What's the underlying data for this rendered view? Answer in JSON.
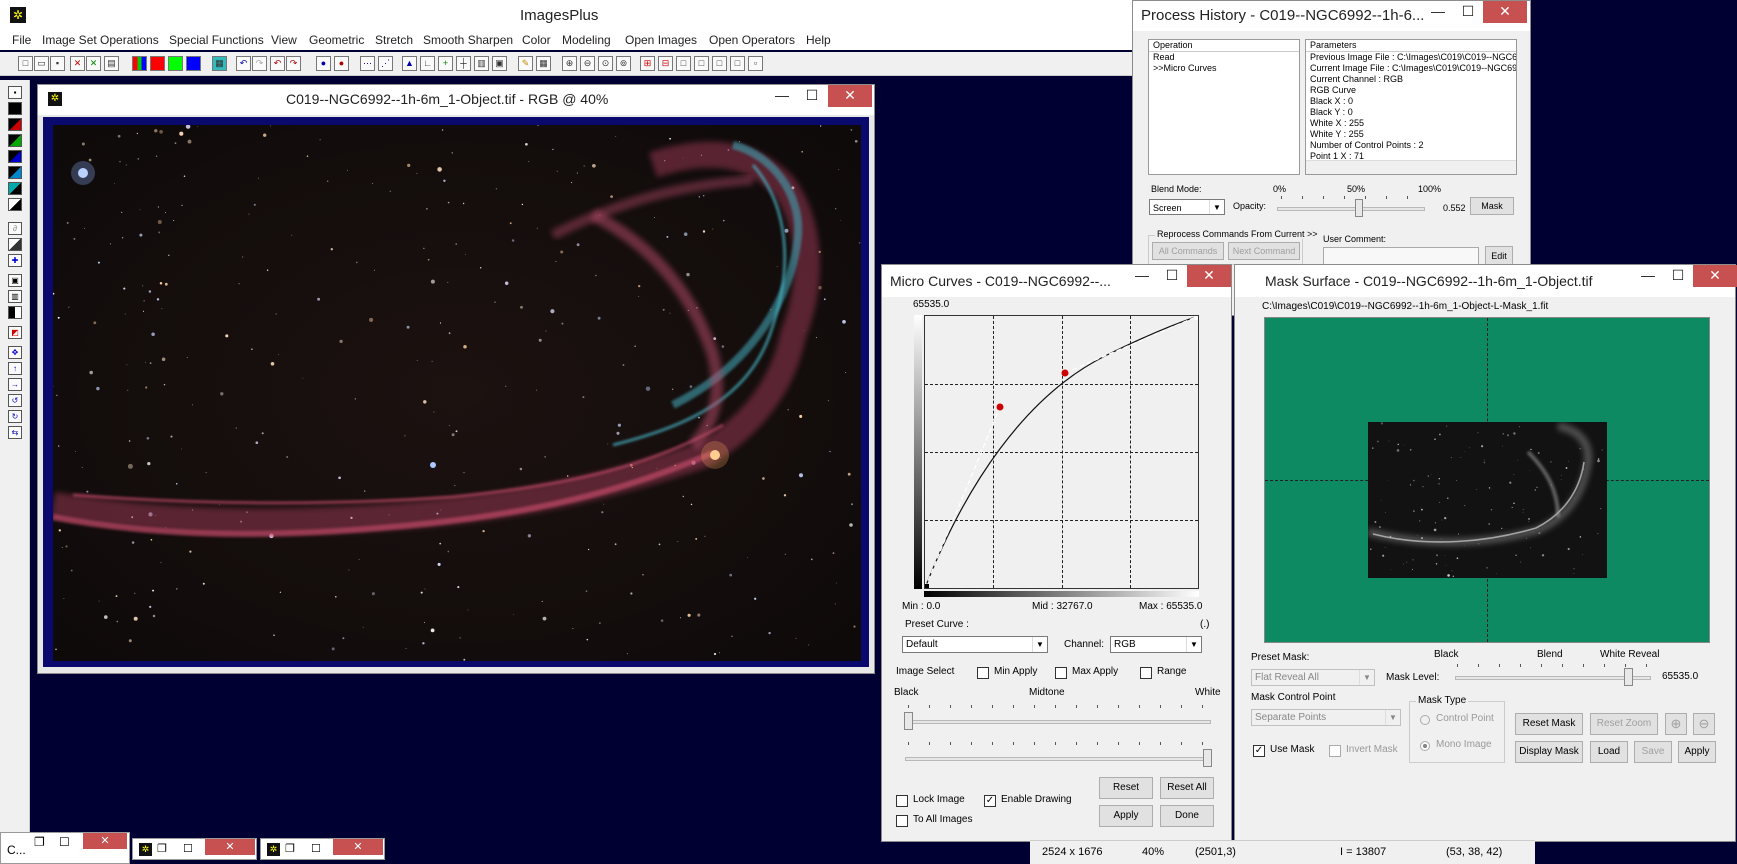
{
  "app": {
    "title": "ImagesPlus"
  },
  "menu": [
    "File",
    "Image Set Operations",
    "Special Functions",
    "View",
    "Geometric",
    "Stretch",
    "Smooth Sharpen",
    "Color",
    "Modeling",
    "Open Images",
    "Open Operators",
    "Help"
  ],
  "image_window": {
    "title": "C019--NGC6992--1h-6m_1-Object.tif - RGB @ 40%"
  },
  "process_history": {
    "title": "Process History - C019--NGC6992--1h-6...",
    "operation_header": "Operation",
    "operations": [
      "Read",
      ">>Micro Curves"
    ],
    "parameters_header": "Parameters",
    "parameters": [
      "Previous Image File : C:\\Images\\C019\\C019--NGC6",
      "Current Image File : C:\\Images\\C019\\C019--NGC69",
      "Current Channel : RGB",
      "RGB Curve",
      "Black X : 0",
      "Black Y : 0",
      "White X : 255",
      "White Y : 255",
      "Number of Control Points : 2",
      "Point 1 X : 71"
    ],
    "blend_mode_label": "Blend Mode:",
    "blend_mode_value": "Screen",
    "opacity_label": "Opacity:",
    "pct_0": "0%",
    "pct_50": "50%",
    "pct_100": "100%",
    "opacity_value": "0.552",
    "opacity_level": 0.552,
    "mask_button": "Mask",
    "reprocess_label": "Reprocess Commands From Current >>",
    "all_commands": "All Commands",
    "next_command": "Next Command",
    "user_comment_label": "User Comment:",
    "edit_button": "Edit"
  },
  "micro_curves": {
    "title": "Micro Curves - C019--NGC6992--...",
    "top_value": "65535.0",
    "min_label": "Min : 0.0",
    "mid_label": "Mid : 32767.0",
    "max_label": "Max : 65535.0",
    "preset_curve_label": "Preset Curve :",
    "preset_curve_suffix": "(.)",
    "preset_value": "Default",
    "channel_label": "Channel:",
    "channel_value": "RGB",
    "image_select_label": "Image Select",
    "min_apply": "Min Apply",
    "max_apply": "Max Apply",
    "range": "Range",
    "black": "Black",
    "midtone": "Midtone",
    "white": "White",
    "lock_image": "Lock Image",
    "enable_drawing": "Enable Drawing",
    "to_all_images": "To All Images",
    "reset": "Reset",
    "reset_all": "Reset All",
    "apply": "Apply",
    "done": "Done",
    "plot_color": "#0e8a62"
  },
  "mask_surface": {
    "title": "Mask Surface - C019--NGC6992--1h-6m_1-Object.tif",
    "path": "C:\\Images\\C019\\C019--NGC6992--1h-6m_1-Object-L-Mask_1.fit",
    "preset_mask_label": "Preset Mask:",
    "preset_mask_value": "Flat Reveal All",
    "black": "Black",
    "blend": "Blend",
    "white_reveal": "White Reveal",
    "mask_level_label": "Mask Level:",
    "mask_level_value": "65535.0",
    "mask_control_point_label": "Mask Control Point",
    "mask_control_point_value": "Separate Points",
    "mask_type_label": "Mask Type",
    "control_point": "Control Point",
    "mono_image": "Mono Image",
    "reset_mask": "Reset Mask",
    "reset_zoom": "Reset Zoom",
    "use_mask": "Use Mask",
    "invert_mask": "Invert Mask",
    "display_mask": "Display Mask",
    "load": "Load",
    "save": "Save",
    "apply": "Apply"
  },
  "status_bar": {
    "dimensions": "2524 x 1676",
    "zoom": "40%",
    "coords": "(2501,3)",
    "intensity": "I = 13807",
    "rgb": "(53, 38, 42)"
  },
  "taskbar": {
    "item1": "C..."
  }
}
